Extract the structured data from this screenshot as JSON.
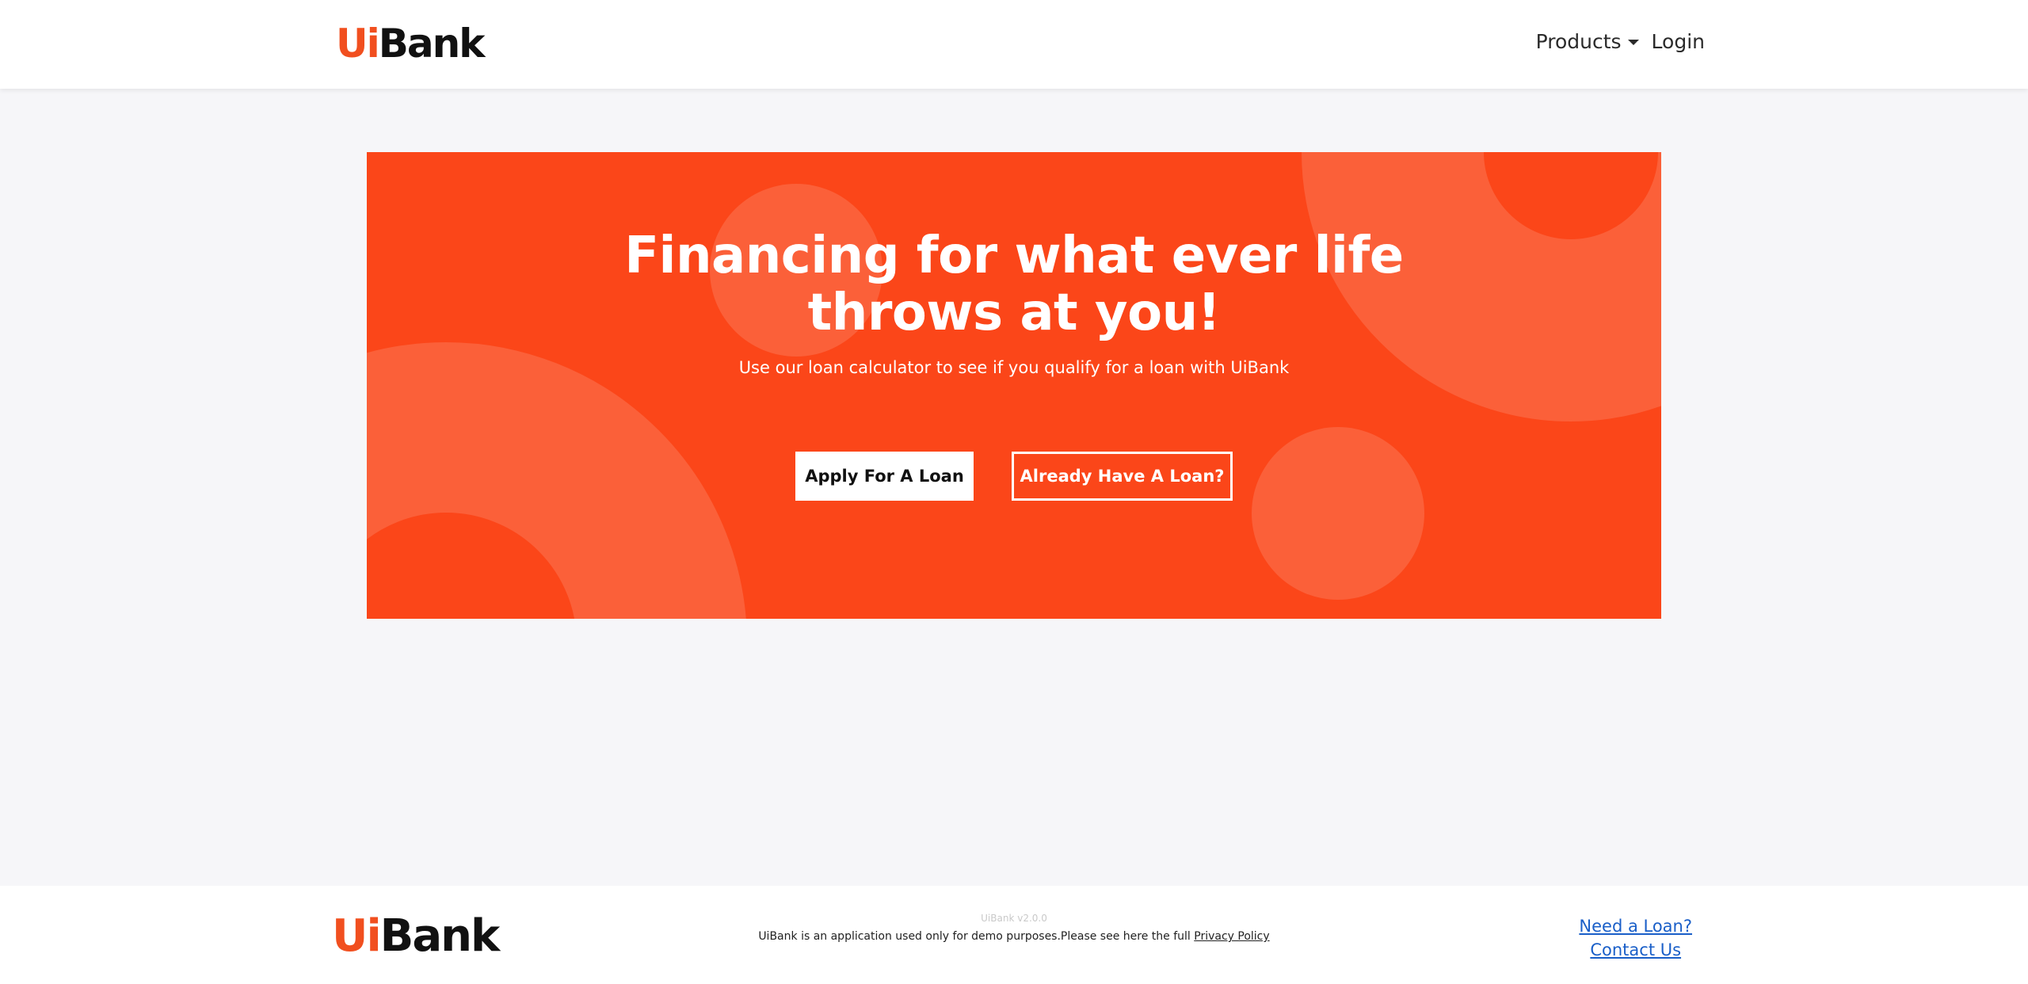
{
  "brand": {
    "logo_part1": "Ui",
    "logo_part2": "Bank",
    "accent_color": "#fb4619",
    "logo_orange": "#f14f1f"
  },
  "header": {
    "nav": {
      "products_label": "Products",
      "login_label": "Login"
    }
  },
  "hero": {
    "title": "Financing for what ever life throws at you!",
    "subtitle": "Use our loan calculator to see if you qualify for a loan with UiBank",
    "apply_button": "Apply For A Loan",
    "have_loan_button": "Already Have A Loan?"
  },
  "footer": {
    "version": "UiBank v2.0.0",
    "disclaimer": "UiBank is an application used only for demo purposes.Please see here the full ",
    "privacy_link": "Privacy Policy",
    "need_loan_link": "Need a Loan?",
    "contact_link": "Contact Us",
    "link_color": "#1a5fc8"
  },
  "icons": {
    "dropdown": "chevron-down-icon"
  }
}
